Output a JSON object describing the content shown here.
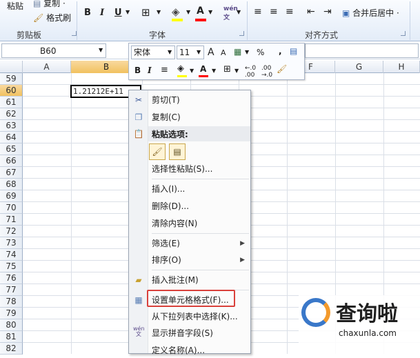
{
  "ribbon": {
    "paste_label": "粘贴",
    "copy_label": "复制 ·",
    "format_painter_label": "格式刷",
    "clipboard_group": "剪贴板",
    "font_group": "字体",
    "align_group": "对齐方式",
    "merge_label": "合并后居中 ·"
  },
  "formula_bar": {
    "name_box": "B60"
  },
  "mini_toolbar": {
    "font_name": "宋体",
    "font_size": "11",
    "grow_label": "A",
    "shrink_label": "A",
    "percent_label": "%",
    "comma_label": ","
  },
  "columns": [
    "A",
    "B",
    "C",
    "D",
    "E",
    "F",
    "G",
    "H"
  ],
  "rows": [
    "59",
    "60",
    "61",
    "62",
    "63",
    "64",
    "65",
    "66",
    "67",
    "68",
    "69",
    "70",
    "71",
    "72",
    "73",
    "74",
    "75",
    "76",
    "77",
    "78",
    "79",
    "80",
    "81",
    "82"
  ],
  "active_cell": {
    "value": "1.21212E+11"
  },
  "context_menu": {
    "items": [
      {
        "label": "剪切(T)",
        "icon": "scissors-icon"
      },
      {
        "label": "复制(C)",
        "icon": "copy-icon"
      },
      {
        "label": "粘贴选项:",
        "icon": "paste-icon"
      },
      {
        "label": "选择性粘贴(S)..."
      },
      {
        "label": "插入(I)..."
      },
      {
        "label": "删除(D)..."
      },
      {
        "label": "清除内容(N)"
      },
      {
        "label": "筛选(E)"
      },
      {
        "label": "排序(O)"
      },
      {
        "label": "插入批注(M)",
        "icon": "comment-icon"
      },
      {
        "label": "设置单元格格式(F)...",
        "icon": "format-cells-icon"
      },
      {
        "label": "从下拉列表中选择(K)..."
      },
      {
        "label": "显示拼音字段(S)",
        "icon": "phonetic-icon"
      },
      {
        "label": "定义名称(A)..."
      }
    ]
  },
  "watermark": {
    "title": "查询啦",
    "url": "chaxunla.com"
  },
  "colors": {
    "highlight": "#d9403b",
    "selected_header": "#f1c15f",
    "ribbon_bg": "#e3ecf8"
  }
}
